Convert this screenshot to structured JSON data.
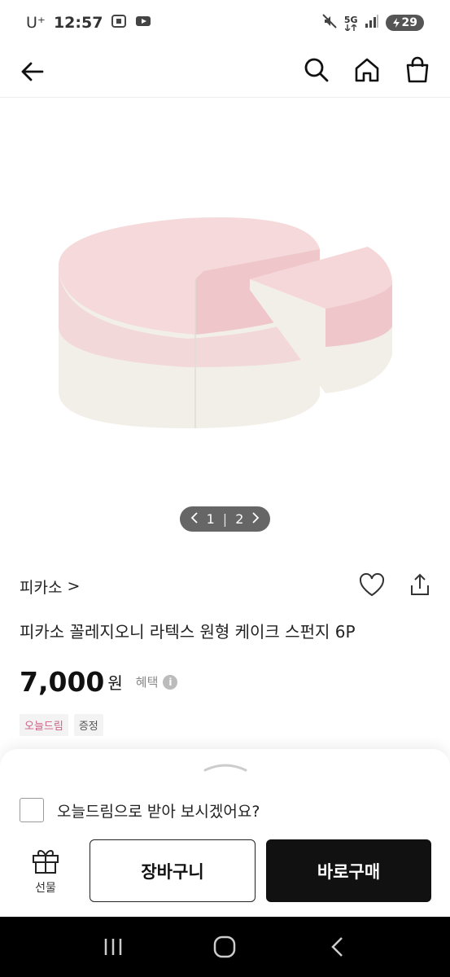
{
  "status_bar": {
    "carrier": "U⁺",
    "time": "12:57",
    "network": "5G",
    "battery": "29"
  },
  "app_bar": {
    "icons": [
      "back-arrow-icon",
      "search-icon",
      "home-icon",
      "shopping-bag-icon"
    ]
  },
  "gallery": {
    "current": "1",
    "separator": "|",
    "total": "2"
  },
  "product": {
    "brand": "피카소",
    "brand_chevron": ">",
    "title": "피카소 꼴레지오니 라텍스 원형 케이크 스펀지 6P",
    "price": "7,000",
    "currency": "원",
    "benefit_label": "혜택",
    "benefit_info": "i",
    "tags": [
      {
        "label": "오늘드림",
        "color": "#d35f86"
      },
      {
        "label": "증정",
        "color": "#555555"
      }
    ]
  },
  "sheet": {
    "checkbox_label": "오늘드림으로 받아 보시겠어요?",
    "checkbox_checked": false,
    "gift_label": "선물",
    "cart_button": "장바구니",
    "buy_button": "바로구매"
  },
  "nav_bar": {
    "icons": [
      "recent-apps-icon",
      "home-button-icon",
      "back-button-icon"
    ]
  }
}
